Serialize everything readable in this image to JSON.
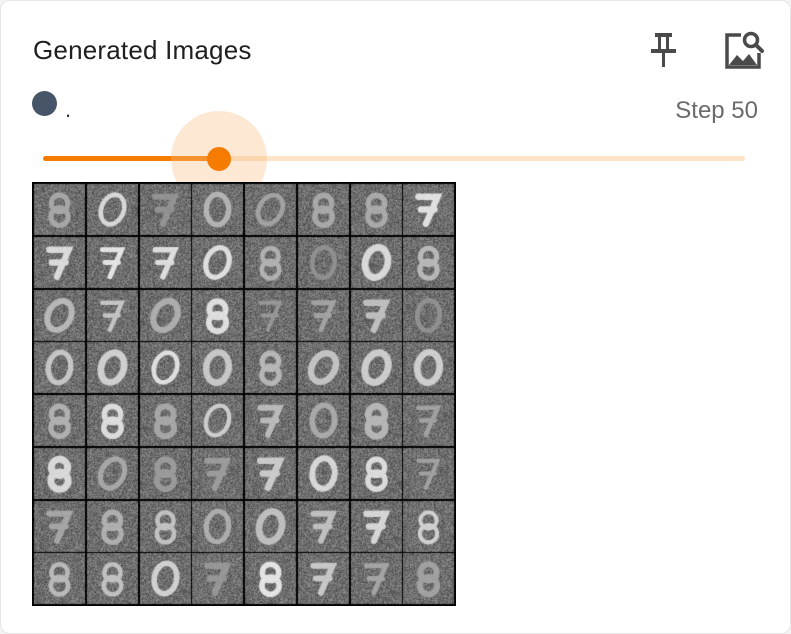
{
  "panel": {
    "title": "Generated Images",
    "icons": {
      "pin": "pin-icon",
      "image_inspect": "image-search-icon"
    }
  },
  "run": {
    "name": ".",
    "color": "#475569"
  },
  "step": {
    "label": "Step 50",
    "fraction": 0.25
  },
  "colors": {
    "accent": "#f57c00",
    "track": "#fde3c8"
  },
  "image_grid": {
    "rows": 8,
    "cols": 8
  }
}
